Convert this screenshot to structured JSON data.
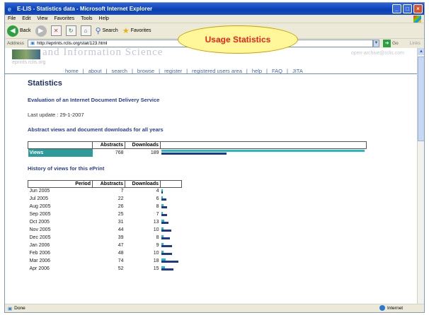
{
  "window": {
    "title": "E-LIS - Statistics data - Microsoft Internet Explorer"
  },
  "menu": [
    "File",
    "Edit",
    "View",
    "Favorites",
    "Tools",
    "Help"
  ],
  "toolbar": {
    "back_label": "Back",
    "search_label": "Search",
    "favorites_label": "Favorites"
  },
  "callout": "Usage Statistics",
  "address": {
    "label": "Address",
    "url": "http://eprints.rclis.org/stat/123.html",
    "go_label": "Go",
    "links_label": "Links"
  },
  "banner": {
    "title": "and Information Science",
    "url": "eprints.rclis.org",
    "mail": "open-archive@rclis.com"
  },
  "nav": [
    "home",
    "about",
    "search",
    "browse",
    "register",
    "registered users area",
    "help",
    "FAQ",
    "JITA"
  ],
  "page": {
    "title": "Statistics",
    "doc_title": "Evaluation of an Internet Document Delivery Service",
    "last_update": "Last update : 29-1-2007",
    "section1": "Abstract views and document downloads for all years",
    "section2": "History of views for this ePrint"
  },
  "summary_table": {
    "headers": [
      "",
      "Abstracts",
      "Downloads",
      ""
    ],
    "row": {
      "label": "Views",
      "abstracts": "768",
      "downloads": "189"
    }
  },
  "history_table": {
    "headers": [
      "Period",
      "Abstracts",
      "Downloads",
      ""
    ],
    "rows": [
      {
        "period": "Jun 2005",
        "abstracts": "7",
        "downloads": "4"
      },
      {
        "period": "Jul 2005",
        "abstracts": "22",
        "downloads": "6"
      },
      {
        "period": "Aug 2005",
        "abstracts": "26",
        "downloads": "8"
      },
      {
        "period": "Sep 2005",
        "abstracts": "25",
        "downloads": "7"
      },
      {
        "period": "Oct 2005",
        "abstracts": "31",
        "downloads": "13"
      },
      {
        "period": "Nov 2005",
        "abstracts": "44",
        "downloads": "10"
      },
      {
        "period": "Dec 2005",
        "abstracts": "39",
        "downloads": "8"
      },
      {
        "period": "Jan 2006",
        "abstracts": "47",
        "downloads": "9"
      },
      {
        "period": "Feb 2006",
        "abstracts": "48",
        "downloads": "10"
      },
      {
        "period": "Mar 2006",
        "abstracts": "74",
        "downloads": "18"
      },
      {
        "period": "Apr 2006",
        "abstracts": "52",
        "downloads": "15"
      }
    ]
  },
  "status": {
    "left": "Done",
    "zone": "Internet"
  },
  "colors": {
    "abstract_bar": "#1d3a8f",
    "download_bar": "#27b8c8",
    "views_cell": "#2e9a9a",
    "callout_text": "#e8251a"
  }
}
